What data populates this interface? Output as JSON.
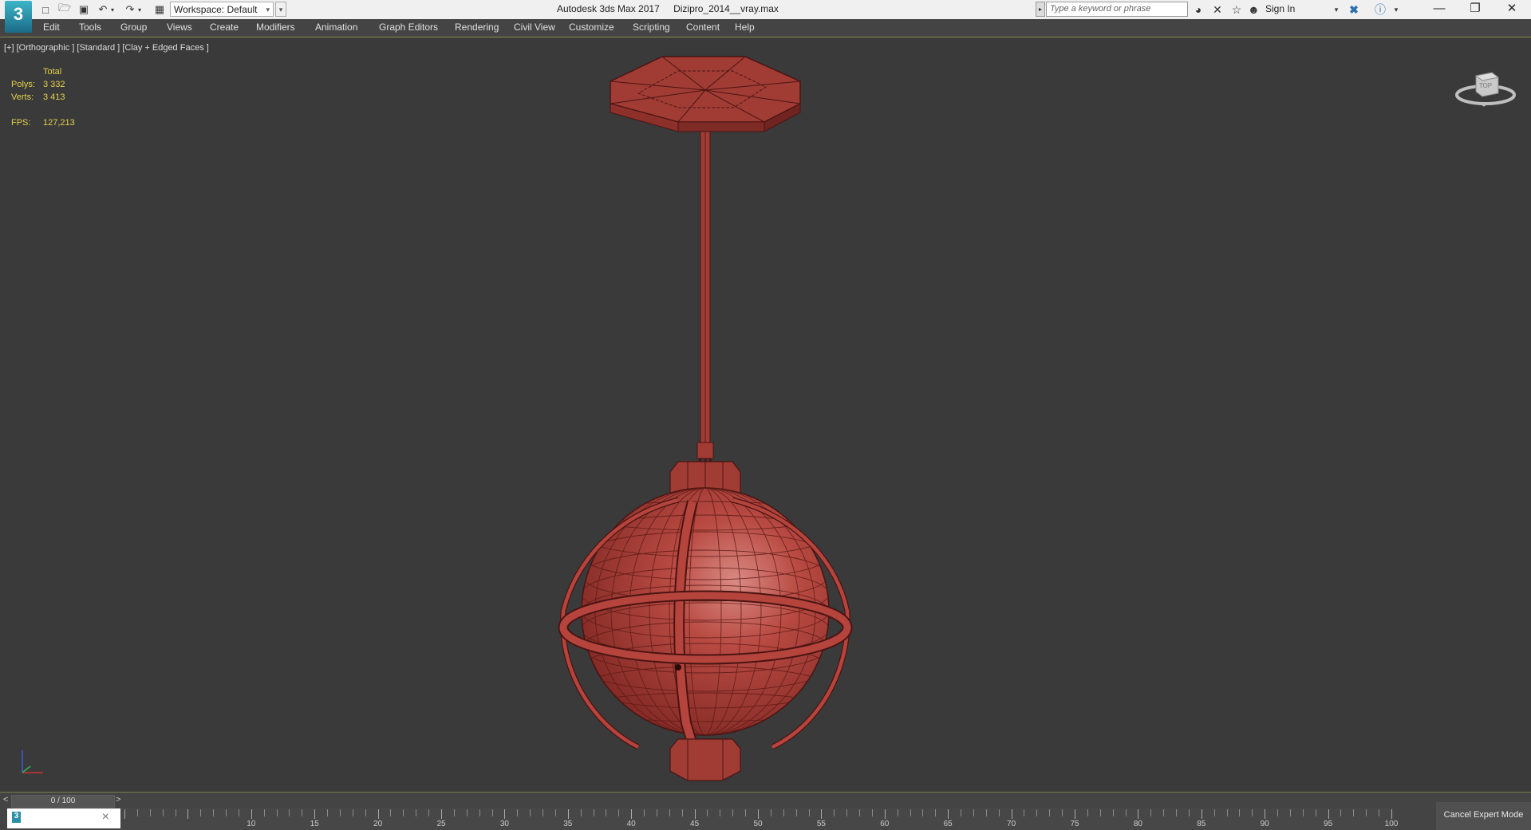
{
  "app": {
    "title": "Autodesk 3ds Max 2017",
    "file": "Dizipro_2014__vray.max",
    "logo": "3"
  },
  "toolbar": {
    "workspace": "Workspace: Default",
    "search_placeholder": "Type a keyword or phrase",
    "sign_in": "Sign In"
  },
  "menu": [
    "Edit",
    "Tools",
    "Group",
    "Views",
    "Create",
    "Modifiers",
    "Animation",
    "Graph Editors",
    "Rendering",
    "Civil View",
    "Customize",
    "Scripting",
    "Content",
    "Help"
  ],
  "viewport": {
    "label": "[+] [Orthographic ] [Standard ] [Clay + Edged Faces ]",
    "stats": {
      "header": "Total",
      "polys_label": "Polys:",
      "polys": "3 332",
      "verts_label": "Verts:",
      "verts": "3 413",
      "fps_label": "FPS:",
      "fps": "127,213"
    },
    "viewcube_label": "TOP"
  },
  "timeline": {
    "frame": "0 / 100",
    "prev": "<",
    "next": ">",
    "ticks": [
      "10",
      "15",
      "20",
      "25",
      "30",
      "35",
      "40",
      "45",
      "50",
      "55",
      "60",
      "65",
      "70",
      "75",
      "80",
      "85",
      "90",
      "95",
      "100"
    ]
  },
  "status": {
    "cancel_expert": "Cancel Expert Mode"
  },
  "colors": {
    "model": "#b5443d",
    "viewport_bg": "#3a3a3a",
    "stats_text": "#e5d24a"
  }
}
